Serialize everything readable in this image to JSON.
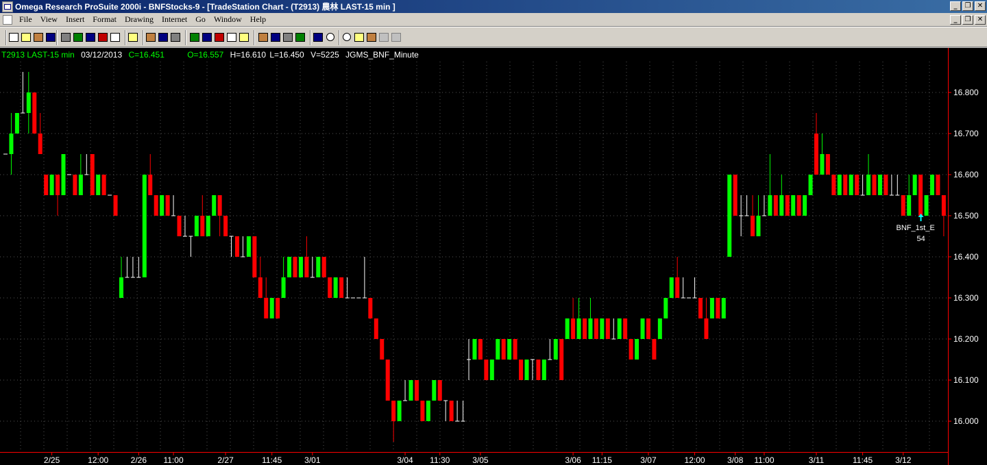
{
  "window": {
    "title": "Omega Research ProSuite 2000i - BNFStocks-9 - [TradeStation Chart - (T2913) 農林 LAST-15 min ]"
  },
  "menu": {
    "items": [
      "File",
      "View",
      "Insert",
      "Format",
      "Drawing",
      "Internet",
      "Go",
      "Window",
      "Help"
    ]
  },
  "toolbar": {
    "icons": [
      "new-icon",
      "open-icon",
      "open-folder-icon",
      "save-icon",
      "print-icon",
      "chart-icon",
      "refresh-icon",
      "export-icon",
      "print-preview-icon",
      "properties-icon",
      "back-icon",
      "forward-icon",
      "next-icon",
      "insert-analysis-icon",
      "insert-study-icon",
      "format-icon",
      "window-icon",
      "grid-icon",
      "data-window-icon",
      "table-icon",
      "bar-spacing-icon",
      "compress-icon",
      "expand-icon",
      "zoom-in-icon",
      "zoom-out-icon",
      "tools-icon",
      "pointer-icon",
      "gray-cursor-icon",
      "hand-icon"
    ]
  },
  "status": {
    "symbol": "T2913 LAST-15 min",
    "date": "03/12/2013",
    "close": "C=16.451",
    "open": "O=16.557",
    "high": "H=16.610",
    "low": "L=16.450",
    "volume": "V=5225",
    "datasource": "JGMS_BNF_Minute"
  },
  "colors": {
    "up": "#00ff00",
    "down": "#ff0000",
    "flat": "#ffffff",
    "grid": "#555555",
    "axis": "#ff0000",
    "status_green": "#00ff00",
    "status_white": "#ffffff",
    "annotation": "#00ffff"
  },
  "chart_data": {
    "type": "candlestick",
    "ylim": [
      15.97,
      16.88
    ],
    "yticks": [
      "16.800",
      "16.700",
      "16.600",
      "16.500",
      "16.400",
      "16.300",
      "16.200",
      "16.100",
      "16.000"
    ],
    "xticks": [
      {
        "label": "2/25",
        "bar": 8
      },
      {
        "label": "12:00",
        "bar": 16
      },
      {
        "label": "2/26",
        "bar": 23
      },
      {
        "label": "11:00",
        "bar": 29
      },
      {
        "label": "2/27",
        "bar": 38
      },
      {
        "label": "11:45",
        "bar": 46
      },
      {
        "label": "3/01",
        "bar": 53
      },
      {
        "label": "3/04",
        "bar": 69
      },
      {
        "label": "11:30",
        "bar": 75
      },
      {
        "label": "3/05",
        "bar": 82
      },
      {
        "label": "3/06",
        "bar": 98
      },
      {
        "label": "11:15",
        "bar": 103
      },
      {
        "label": "3/07",
        "bar": 111
      },
      {
        "label": "12:00",
        "bar": 119
      },
      {
        "label": "3/08",
        "bar": 126
      },
      {
        "label": "11:00",
        "bar": 131
      },
      {
        "label": "3/11",
        "bar": 140
      },
      {
        "label": "11:45",
        "bar": 148
      },
      {
        "label": "3/12",
        "bar": 155
      }
    ],
    "annotation": {
      "text": "BNF_1st_E",
      "value": "54",
      "bar": 159
    },
    "ohlc": [
      [
        16.65,
        16.6,
        16.6,
        16.65
      ],
      [
        16.65,
        16.75,
        16.6,
        16.7
      ],
      [
        16.7,
        16.75,
        16.7,
        16.75
      ],
      [
        16.75,
        16.85,
        16.75,
        16.75
      ],
      [
        16.75,
        16.85,
        16.7,
        16.8
      ],
      [
        16.8,
        16.8,
        16.7,
        16.7
      ],
      [
        16.7,
        16.75,
        16.65,
        16.65
      ],
      [
        16.6,
        16.6,
        16.55,
        16.55
      ],
      [
        16.55,
        16.6,
        16.55,
        16.6
      ],
      [
        16.6,
        16.6,
        16.5,
        16.55
      ],
      [
        16.55,
        16.65,
        16.55,
        16.65
      ],
      [
        16.6,
        16.6,
        16.6,
        16.6
      ],
      [
        16.6,
        16.6,
        16.55,
        16.55
      ],
      [
        16.55,
        16.65,
        16.55,
        16.6
      ],
      [
        16.6,
        16.65,
        16.6,
        16.6
      ],
      [
        16.65,
        16.65,
        16.55,
        16.55
      ],
      [
        16.55,
        16.6,
        16.55,
        16.6
      ],
      [
        16.6,
        16.6,
        16.55,
        16.55
      ],
      [
        16.55,
        16.55,
        16.55,
        16.55
      ],
      [
        16.55,
        16.55,
        16.5,
        16.5
      ],
      [
        16.3,
        16.4,
        16.3,
        16.35
      ],
      [
        16.35,
        16.4,
        16.35,
        16.35
      ],
      [
        16.35,
        16.4,
        16.35,
        16.35
      ],
      [
        16.35,
        16.4,
        16.35,
        16.35
      ],
      [
        16.35,
        16.6,
        16.35,
        16.6
      ],
      [
        16.6,
        16.65,
        16.6,
        16.55
      ],
      [
        16.55,
        16.55,
        16.5,
        16.5
      ],
      [
        16.5,
        16.55,
        16.5,
        16.55
      ],
      [
        16.55,
        16.55,
        16.5,
        16.5
      ],
      [
        16.5,
        16.55,
        16.5,
        16.5
      ],
      [
        16.5,
        16.5,
        16.45,
        16.45
      ],
      [
        16.45,
        16.5,
        16.45,
        16.45
      ],
      [
        16.45,
        16.45,
        16.4,
        16.45
      ],
      [
        16.45,
        16.5,
        16.45,
        16.5
      ],
      [
        16.5,
        16.55,
        16.45,
        16.45
      ],
      [
        16.45,
        16.5,
        16.45,
        16.5
      ],
      [
        16.5,
        16.55,
        16.5,
        16.55
      ],
      [
        16.55,
        16.55,
        16.45,
        16.5
      ],
      [
        16.5,
        16.5,
        16.45,
        16.45
      ],
      [
        16.45,
        16.45,
        16.4,
        16.45
      ],
      [
        16.45,
        16.45,
        16.4,
        16.4
      ],
      [
        16.4,
        16.45,
        16.4,
        16.4
      ],
      [
        16.4,
        16.45,
        16.4,
        16.45
      ],
      [
        16.45,
        16.45,
        16.35,
        16.35
      ],
      [
        16.35,
        16.4,
        16.3,
        16.3
      ],
      [
        16.3,
        16.35,
        16.3,
        16.25
      ],
      [
        16.25,
        16.3,
        16.25,
        16.3
      ],
      [
        16.3,
        16.3,
        16.25,
        16.25
      ],
      [
        16.3,
        16.4,
        16.3,
        16.35
      ],
      [
        16.35,
        16.4,
        16.35,
        16.4
      ],
      [
        16.4,
        16.4,
        16.35,
        16.35
      ],
      [
        16.35,
        16.4,
        16.35,
        16.4
      ],
      [
        16.4,
        16.45,
        16.35,
        16.35
      ],
      [
        16.35,
        16.4,
        16.35,
        16.35
      ],
      [
        16.35,
        16.4,
        16.35,
        16.4
      ],
      [
        16.4,
        16.4,
        16.35,
        16.35
      ],
      [
        16.35,
        16.35,
        16.3,
        16.3
      ],
      [
        16.3,
        16.35,
        16.3,
        16.35
      ],
      [
        16.35,
        16.35,
        16.3,
        16.3
      ],
      [
        16.3,
        16.35,
        16.3,
        16.3
      ],
      [
        16.3,
        16.3,
        16.3,
        16.3
      ],
      [
        16.3,
        16.3,
        16.3,
        16.3
      ],
      [
        16.3,
        16.4,
        16.3,
        16.3
      ],
      [
        16.3,
        16.3,
        16.25,
        16.25
      ],
      [
        16.25,
        16.25,
        16.2,
        16.2
      ],
      [
        16.2,
        16.2,
        16.15,
        16.15
      ],
      [
        16.15,
        16.15,
        16.05,
        16.05
      ],
      [
        16.05,
        16.05,
        15.95,
        16.0
      ],
      [
        16.0,
        16.05,
        16.0,
        16.05
      ],
      [
        16.05,
        16.1,
        16.05,
        16.05
      ],
      [
        16.05,
        16.1,
        16.05,
        16.1
      ],
      [
        16.1,
        16.1,
        16.05,
        16.05
      ],
      [
        16.05,
        16.05,
        16.0,
        16.0
      ],
      [
        16.0,
        16.05,
        16.0,
        16.05
      ],
      [
        16.05,
        16.1,
        16.05,
        16.1
      ],
      [
        16.1,
        16.1,
        16.05,
        16.05
      ],
      [
        16.05,
        16.05,
        16.0,
        16.05
      ],
      [
        16.05,
        16.05,
        16.0,
        16.0
      ],
      [
        16.0,
        16.05,
        16.0,
        16.0
      ],
      [
        16.0,
        16.05,
        16.0,
        16.0
      ],
      [
        16.15,
        16.2,
        16.1,
        16.15
      ],
      [
        16.15,
        16.2,
        16.15,
        16.2
      ],
      [
        16.2,
        16.2,
        16.15,
        16.15
      ],
      [
        16.15,
        16.15,
        16.1,
        16.1
      ],
      [
        16.1,
        16.15,
        16.1,
        16.15
      ],
      [
        16.15,
        16.2,
        16.15,
        16.2
      ],
      [
        16.2,
        16.2,
        16.15,
        16.15
      ],
      [
        16.15,
        16.2,
        16.15,
        16.2
      ],
      [
        16.2,
        16.2,
        16.15,
        16.15
      ],
      [
        16.15,
        16.15,
        16.1,
        16.1
      ],
      [
        16.1,
        16.15,
        16.1,
        16.15
      ],
      [
        16.15,
        16.15,
        16.1,
        16.15
      ],
      [
        16.15,
        16.15,
        16.1,
        16.1
      ],
      [
        16.1,
        16.15,
        16.1,
        16.15
      ],
      [
        16.15,
        16.2,
        16.15,
        16.15
      ],
      [
        16.15,
        16.2,
        16.15,
        16.2
      ],
      [
        16.2,
        16.2,
        16.1,
        16.1
      ],
      [
        16.2,
        16.25,
        16.2,
        16.25
      ],
      [
        16.25,
        16.3,
        16.2,
        16.2
      ],
      [
        16.2,
        16.3,
        16.2,
        16.25
      ],
      [
        16.25,
        16.25,
        16.2,
        16.2
      ],
      [
        16.2,
        16.3,
        16.2,
        16.25
      ],
      [
        16.25,
        16.25,
        16.2,
        16.2
      ],
      [
        16.2,
        16.25,
        16.2,
        16.25
      ],
      [
        16.25,
        16.25,
        16.2,
        16.2
      ],
      [
        16.2,
        16.25,
        16.2,
        16.2
      ],
      [
        16.2,
        16.25,
        16.2,
        16.25
      ],
      [
        16.25,
        16.25,
        16.2,
        16.2
      ],
      [
        16.2,
        16.2,
        16.15,
        16.15
      ],
      [
        16.15,
        16.2,
        16.15,
        16.2
      ],
      [
        16.2,
        16.25,
        16.2,
        16.25
      ],
      [
        16.25,
        16.25,
        16.2,
        16.2
      ],
      [
        16.2,
        16.2,
        16.15,
        16.15
      ],
      [
        16.2,
        16.25,
        16.2,
        16.25
      ],
      [
        16.25,
        16.3,
        16.25,
        16.3
      ],
      [
        16.3,
        16.35,
        16.3,
        16.35
      ],
      [
        16.35,
        16.4,
        16.3,
        16.3
      ],
      [
        16.3,
        16.35,
        16.3,
        16.3
      ],
      [
        16.3,
        16.3,
        16.3,
        16.3
      ],
      [
        16.3,
        16.35,
        16.3,
        16.3
      ],
      [
        16.3,
        16.3,
        16.25,
        16.25
      ],
      [
        16.25,
        16.3,
        16.2,
        16.2
      ],
      [
        16.25,
        16.3,
        16.25,
        16.3
      ],
      [
        16.3,
        16.3,
        16.25,
        16.25
      ],
      [
        16.25,
        16.3,
        16.25,
        16.3
      ],
      [
        16.4,
        16.6,
        16.4,
        16.6
      ],
      [
        16.6,
        16.6,
        16.5,
        16.5
      ],
      [
        16.5,
        16.55,
        16.45,
        16.5
      ],
      [
        16.5,
        16.55,
        16.5,
        16.5
      ],
      [
        16.5,
        16.55,
        16.45,
        16.45
      ],
      [
        16.45,
        16.55,
        16.45,
        16.5
      ],
      [
        16.5,
        16.55,
        16.5,
        16.5
      ],
      [
        16.5,
        16.65,
        16.5,
        16.55
      ],
      [
        16.55,
        16.55,
        16.5,
        16.5
      ],
      [
        16.5,
        16.6,
        16.5,
        16.55
      ],
      [
        16.55,
        16.55,
        16.5,
        16.5
      ],
      [
        16.5,
        16.55,
        16.5,
        16.55
      ],
      [
        16.55,
        16.55,
        16.5,
        16.5
      ],
      [
        16.5,
        16.55,
        16.5,
        16.55
      ],
      [
        16.55,
        16.6,
        16.55,
        16.6
      ],
      [
        16.7,
        16.75,
        16.65,
        16.6
      ],
      [
        16.6,
        16.7,
        16.6,
        16.65
      ],
      [
        16.65,
        16.65,
        16.6,
        16.6
      ],
      [
        16.6,
        16.6,
        16.55,
        16.55
      ],
      [
        16.55,
        16.6,
        16.55,
        16.6
      ],
      [
        16.6,
        16.6,
        16.55,
        16.55
      ],
      [
        16.55,
        16.6,
        16.55,
        16.6
      ],
      [
        16.6,
        16.6,
        16.55,
        16.55
      ],
      [
        16.55,
        16.6,
        16.55,
        16.55
      ],
      [
        16.55,
        16.65,
        16.55,
        16.6
      ],
      [
        16.6,
        16.6,
        16.55,
        16.55
      ],
      [
        16.55,
        16.6,
        16.55,
        16.6
      ],
      [
        16.6,
        16.6,
        16.55,
        16.55
      ],
      [
        16.55,
        16.6,
        16.55,
        16.55
      ],
      [
        16.55,
        16.6,
        16.55,
        16.55
      ],
      [
        16.55,
        16.55,
        16.5,
        16.5
      ],
      [
        16.5,
        16.6,
        16.5,
        16.55
      ],
      [
        16.55,
        16.6,
        16.55,
        16.6
      ],
      [
        16.6,
        16.6,
        16.5,
        16.5
      ],
      [
        16.5,
        16.55,
        16.5,
        16.55
      ],
      [
        16.55,
        16.6,
        16.55,
        16.6
      ],
      [
        16.6,
        16.6,
        16.55,
        16.55
      ],
      [
        16.55,
        16.55,
        16.45,
        16.5
      ]
    ]
  }
}
